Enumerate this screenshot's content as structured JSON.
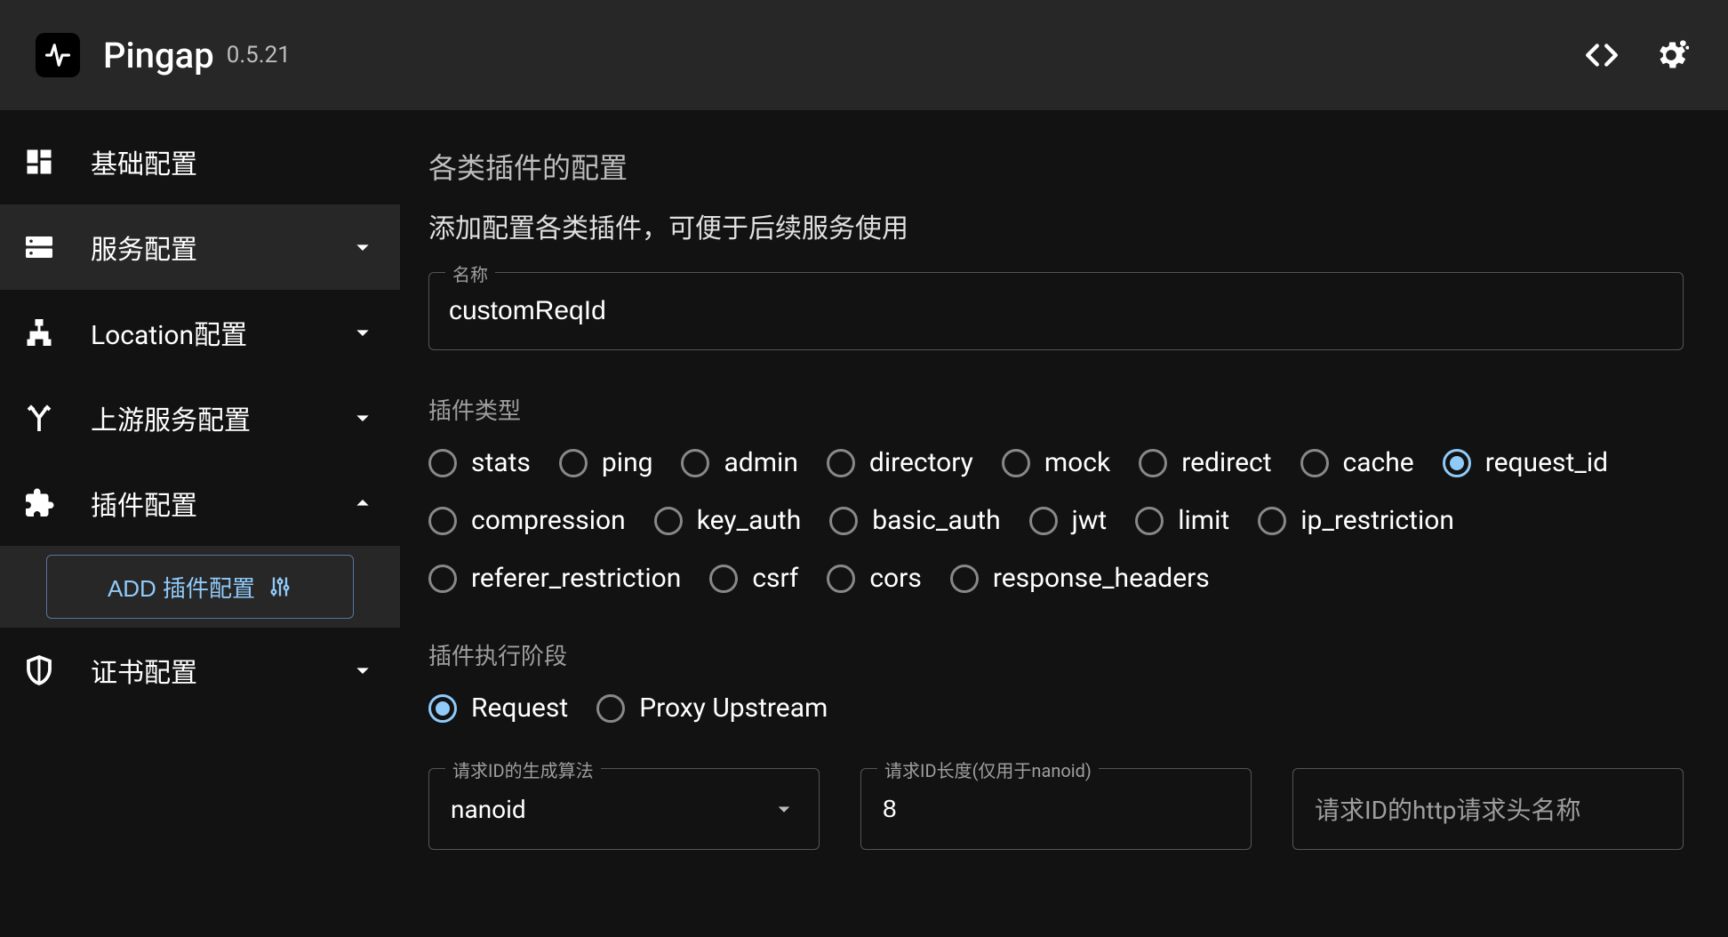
{
  "header": {
    "app_name": "Pingap",
    "version": "0.5.21"
  },
  "sidebar": {
    "items": [
      {
        "label": "基础配置",
        "expandable": false
      },
      {
        "label": "服务配置",
        "expandable": true
      },
      {
        "label": "Location配置",
        "expandable": true
      },
      {
        "label": "上游服务配置",
        "expandable": true
      },
      {
        "label": "插件配置",
        "expandable": true,
        "expanded": true
      },
      {
        "label": "证书配置",
        "expandable": true
      }
    ],
    "add_button_label": "ADD 插件配置"
  },
  "main": {
    "title": "各类插件的配置",
    "subtitle": "添加配置各类插件，可便于后续服务使用",
    "name_label": "名称",
    "name_value": "customReqId",
    "plugin_type_label": "插件类型",
    "plugin_types": [
      "stats",
      "ping",
      "admin",
      "directory",
      "mock",
      "redirect",
      "cache",
      "request_id",
      "compression",
      "key_auth",
      "basic_auth",
      "jwt",
      "limit",
      "ip_restriction",
      "referer_restriction",
      "csrf",
      "cors",
      "response_headers"
    ],
    "plugin_type_selected": "request_id",
    "exec_stage_label": "插件执行阶段",
    "exec_stages": [
      "Request",
      "Proxy Upstream"
    ],
    "exec_stage_selected": "Request",
    "algo_label": "请求ID的生成算法",
    "algo_value": "nanoid",
    "len_label": "请求ID长度(仅用于nanoid)",
    "len_value": "8",
    "header_name_placeholder": "请求ID的http请求头名称"
  }
}
